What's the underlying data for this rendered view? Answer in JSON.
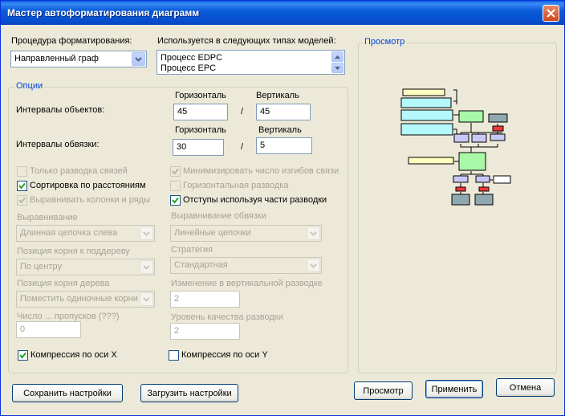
{
  "dialog": {
    "title": "Мастер автоформатирования диаграмм"
  },
  "procedure": {
    "label": "Процедура форматирования:",
    "value": "Направленный граф"
  },
  "models": {
    "label": "Используется в следующих типах моделей:",
    "items": [
      "Процесс EDPC",
      "Процесс EPC"
    ]
  },
  "options": {
    "title": "Опции",
    "object_intervals": "Интервалы объектов:",
    "link_intervals": "Интервалы обвязки:",
    "horizontal": "Горизонталь",
    "vertical": "Вертикаль",
    "separator": "/",
    "obj_h": "45",
    "obj_v": "45",
    "link_h": "30",
    "link_v": "5",
    "checks": {
      "only_links": "Только разводка связей",
      "sort_distance": "Сортировка по расстояниям",
      "align_columns": "Выравнивать колонки и ряды",
      "minimize_bends": "Минимизировать число изгибов связи",
      "horizontal_routing": "Горизонтальная разводка",
      "indents_routing": "Отступы используя части разводки",
      "compress_x": "Компрессия по оси X",
      "compress_y": "Компрессия по оси Y"
    },
    "alignment": {
      "label": "Выравнивание",
      "value": "Длинная цепочка слева"
    },
    "root_subtree": {
      "label": "Позиция корня к поддереву",
      "value": "По центру"
    },
    "root_tree": {
      "label": "Позиция корня дерева",
      "value": "Поместить одиночные корни"
    },
    "gaps": {
      "label": "Число ... пропусков (???)",
      "value": "0"
    },
    "link_alignment": {
      "label": "Выравнивание обвязки",
      "value": "Линейные цепочки"
    },
    "strategy": {
      "label": "Стратегия",
      "value": "Стандартная"
    },
    "vertical_change": {
      "label": "Изменение в вертикальной разводке",
      "value": "2"
    },
    "quality": {
      "label": "Уровень качества разводки",
      "value": "2"
    }
  },
  "preview": {
    "title": "Просмотр"
  },
  "buttons": {
    "save": "Сохранить настройки",
    "load": "Загрузить настройки",
    "preview": "Просмотр",
    "apply": "Применить",
    "cancel": "Отмена"
  },
  "colors": {
    "title_bar": "#0a5cd8",
    "group_title": "#0046d5",
    "node_yellow": "#ffffc0",
    "node_cyan": "#b4f8fc",
    "node_green": "#a8f8a8",
    "node_purple": "#c8c8f8",
    "node_red": "#f03838",
    "node_gray": "#90a8b0",
    "node_white": "#ffffff"
  }
}
